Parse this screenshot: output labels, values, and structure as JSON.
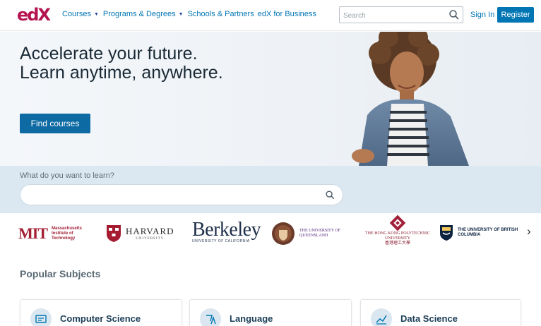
{
  "header": {
    "logo_text": "edX",
    "nav": [
      {
        "label": "Courses",
        "has_caret": true
      },
      {
        "label": "Programs & Degrees",
        "has_caret": true
      },
      {
        "label": "Schools & Partners",
        "has_caret": false
      },
      {
        "label": "edX for Business",
        "has_caret": false
      }
    ],
    "search_placeholder": "Search",
    "sign_in_label": "Sign In",
    "register_label": "Register"
  },
  "hero": {
    "title": "Accelerate your future. Learn anytime, anywhere.",
    "cta_label": "Find courses"
  },
  "search_band": {
    "label": "What do you want to learn?",
    "placeholder": ""
  },
  "partners": {
    "mit": {
      "mark": "MIT",
      "text": "Massachusetts Institute of Technology"
    },
    "harvard": {
      "name": "HARVARD",
      "sub": "UNIVERSITY"
    },
    "berkeley": {
      "name": "Berkeley",
      "sub": "UNIVERSITY OF CALIFORNIA"
    },
    "queensland": {
      "text": "THE UNIVERSITY OF QUEENSLAND"
    },
    "hkpoly": {
      "text": "THE HONG KONG POLYTECHNIC UNIVERSITY",
      "sub": "香港理工大學"
    },
    "ubc": {
      "text": "THE UNIVERSITY OF BRITISH COLUMBIA"
    }
  },
  "popular": {
    "title": "Popular Subjects",
    "subjects": [
      {
        "label": "Computer Science",
        "icon": "code-icon"
      },
      {
        "label": "Language",
        "icon": "translate-icon"
      },
      {
        "label": "Data Science",
        "icon": "chart-icon"
      }
    ]
  },
  "colors": {
    "brand_blue": "#0075b4",
    "brand_magenta": "#b5134e",
    "band_blue": "#dbe8f2"
  }
}
